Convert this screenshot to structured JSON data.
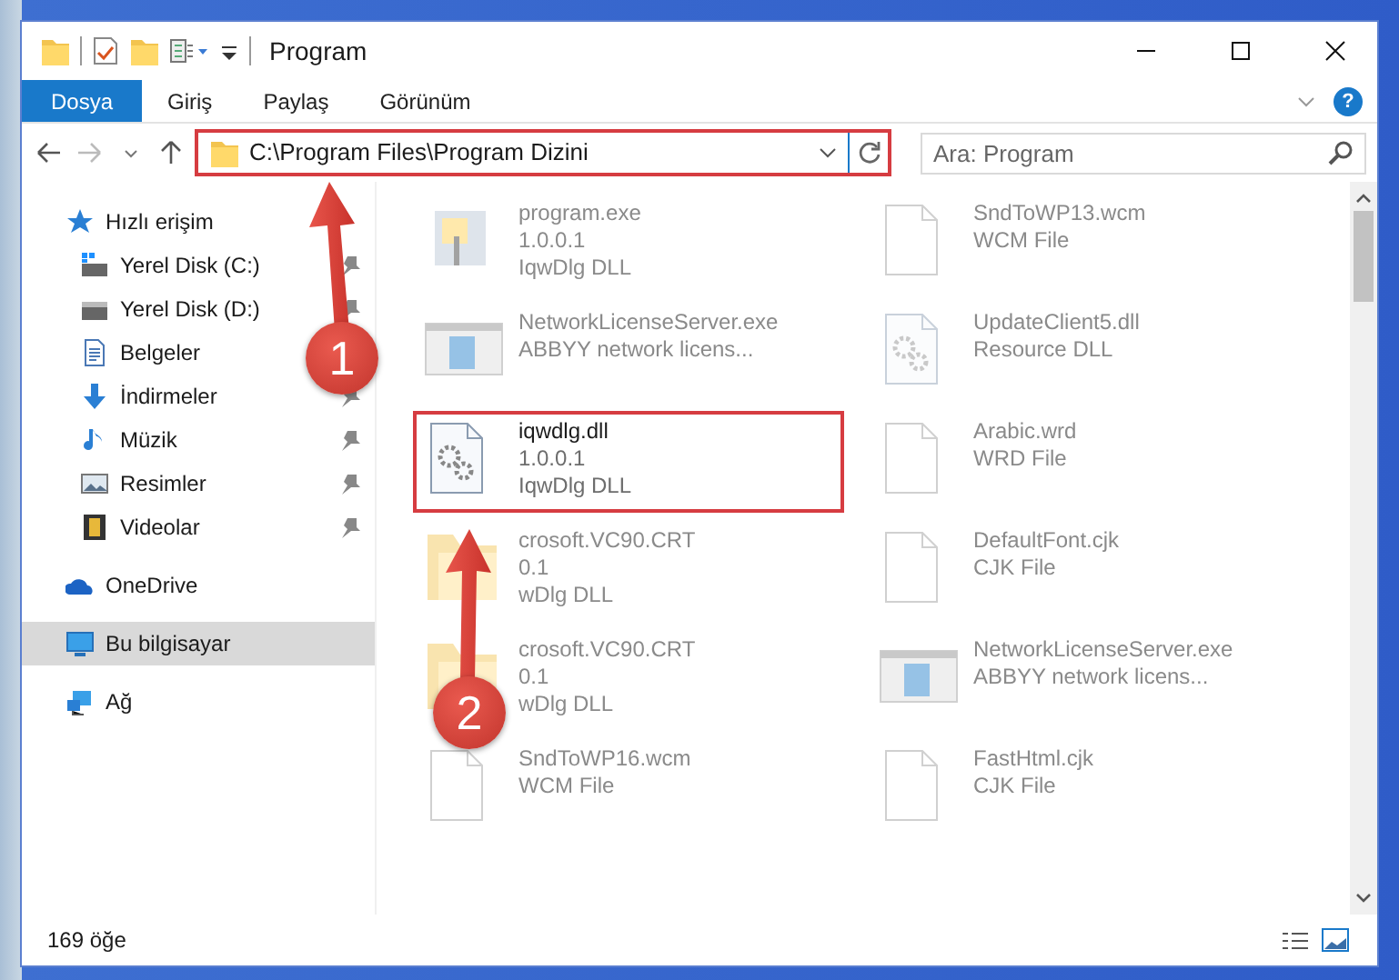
{
  "window": {
    "title": "Program",
    "controls": [
      {
        "kind": "minimize"
      },
      {
        "kind": "maximize"
      },
      {
        "kind": "close"
      }
    ]
  },
  "ribbon": {
    "tabs": [
      {
        "label": "Dosya",
        "kind": "file-menu"
      },
      {
        "label": "Giriş",
        "kind": "tab"
      },
      {
        "label": "Paylaş",
        "kind": "tab"
      },
      {
        "label": "Görünüm",
        "kind": "tab"
      }
    ],
    "help": "?"
  },
  "address_bar": {
    "path": "C:\\Program Files\\Program Dizini",
    "highlighted": true
  },
  "search": {
    "placeholder": "Ara: Program"
  },
  "sidebar": {
    "items": [
      {
        "label": "Hızlı erişim",
        "selected": false,
        "children": [
          {
            "label": "Yerel Disk (C:)",
            "pinned": true,
            "selected": false
          },
          {
            "label": "Yerel Disk (D:)",
            "pinned": true,
            "selected": false
          },
          {
            "label": "Belgeler",
            "pinned": false,
            "selected": false
          },
          {
            "label": "İndirmeler",
            "pinned": true,
            "selected": false
          },
          {
            "label": "Müzik",
            "pinned": true,
            "selected": false
          },
          {
            "label": "Resimler",
            "pinned": true,
            "selected": false
          },
          {
            "label": "Videolar",
            "pinned": true,
            "selected": false
          }
        ]
      },
      {
        "label": "OneDrive",
        "selected": false
      },
      {
        "label": "Bu bilgisayar",
        "selected": true
      },
      {
        "label": "Ağ",
        "selected": false
      }
    ]
  },
  "files": [
    {
      "name": "program.exe",
      "lines": [
        "1.0.0.1",
        "IqwDlg DLL"
      ],
      "kind": "exe",
      "faded": true,
      "highlighted": false
    },
    {
      "name": "SndToWP13.wcm",
      "lines": [
        "WCM File"
      ],
      "kind": "file",
      "faded": true,
      "highlighted": false
    },
    {
      "name": "NetworkLicenseServer.exe",
      "lines": [
        "ABBYY network licens..."
      ],
      "kind": "app",
      "faded": true,
      "highlighted": false
    },
    {
      "name": "UpdateClient5.dll",
      "lines": [
        "Resource DLL"
      ],
      "kind": "gear",
      "faded": true,
      "highlighted": false
    },
    {
      "name": "iqwdlg.dll",
      "lines": [
        "1.0.0.1",
        "IqwDlg DLL"
      ],
      "kind": "gear",
      "faded": false,
      "highlighted": true
    },
    {
      "name": "Arabic.wrd",
      "lines": [
        "WRD File"
      ],
      "kind": "file",
      "faded": true,
      "highlighted": false
    },
    {
      "name": "crosoft.VC90.CRT",
      "lines": [
        "0.1",
        "wDlg DLL"
      ],
      "kind": "folder",
      "faded": true,
      "highlighted": false
    },
    {
      "name": "DefaultFont.cjk",
      "lines": [
        "CJK File"
      ],
      "kind": "file",
      "faded": true,
      "highlighted": false
    },
    {
      "name": "crosoft.VC90.CRT",
      "lines": [
        "0.1",
        "wDlg DLL"
      ],
      "kind": "folder",
      "faded": true,
      "highlighted": false
    },
    {
      "name": "NetworkLicenseServer.exe",
      "lines": [
        "ABBYY network licens..."
      ],
      "kind": "app",
      "faded": true,
      "highlighted": false
    },
    {
      "name": "SndToWP16.wcm",
      "lines": [
        "WCM File"
      ],
      "kind": "file",
      "faded": true,
      "highlighted": false
    },
    {
      "name": "FastHtml.cjk",
      "lines": [
        "CJK File"
      ],
      "kind": "file",
      "faded": true,
      "highlighted": false
    }
  ],
  "status_bar": {
    "count": "169 öğe"
  },
  "annotations": [
    {
      "number": "1"
    },
    {
      "number": "2"
    }
  ]
}
